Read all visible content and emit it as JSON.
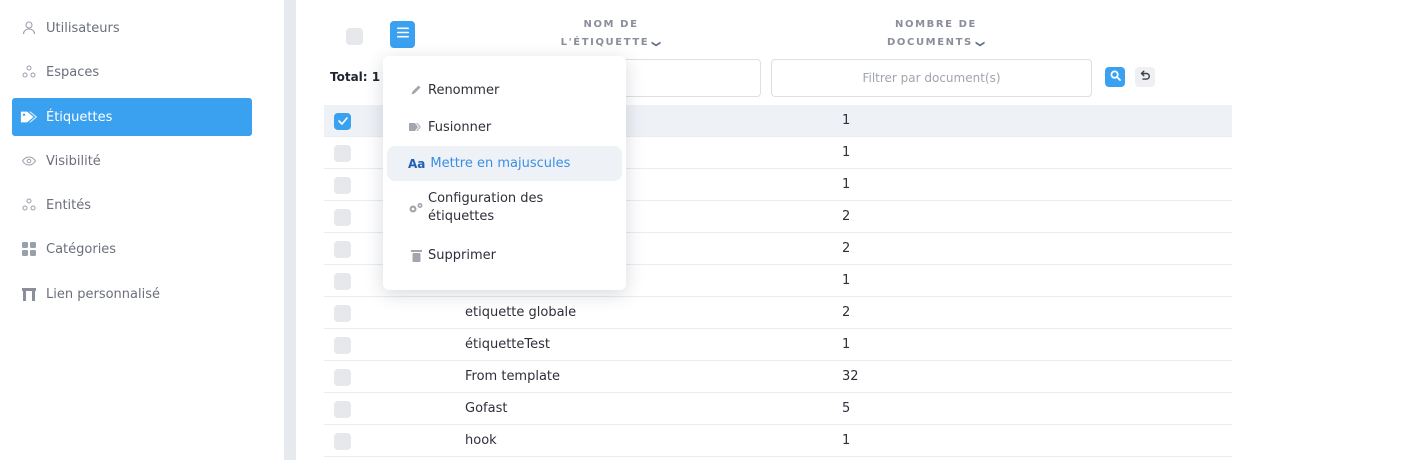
{
  "sidebar": {
    "items": [
      {
        "label": "Utilisateurs",
        "icon": "users-icon"
      },
      {
        "label": "Espaces",
        "icon": "spaces-icon"
      },
      {
        "label": "Étiquettes",
        "icon": "tags-icon",
        "active": true
      },
      {
        "label": "Visibilité",
        "icon": "eye-icon"
      },
      {
        "label": "Entités",
        "icon": "entities-icon"
      },
      {
        "label": "Catégories",
        "icon": "categories-icon"
      },
      {
        "label": "Lien personnalisé",
        "icon": "custom-link-icon"
      }
    ]
  },
  "table": {
    "col_name_line1": "NOM DE",
    "col_name_line2": "L'ÉTIQUETTE",
    "col_docs_line1": "NOMBRE DE",
    "col_docs_line2": "DOCUMENTS",
    "total_label": "Total: 1",
    "filter_doc_placeholder": "Filtrer par document(s)",
    "rows": [
      {
        "name": "",
        "count": "1",
        "checked": true
      },
      {
        "name": "",
        "count": "1"
      },
      {
        "name": "",
        "count": "1"
      },
      {
        "name": "",
        "count": "2"
      },
      {
        "name": "",
        "count": "2"
      },
      {
        "name": "",
        "count": "1"
      },
      {
        "name": "etiquette globale",
        "count": "2"
      },
      {
        "name": "étiquetteTest",
        "count": "1"
      },
      {
        "name": "From template",
        "count": "32"
      },
      {
        "name": "Gofast",
        "count": "5"
      },
      {
        "name": "hook",
        "count": "1"
      }
    ]
  },
  "menu": {
    "rename": "Renommer",
    "merge": "Fusionner",
    "uppercase_prefix": "Aa",
    "uppercase": "Mettre en majuscules",
    "config_line1": "Configuration des",
    "config_line2": "étiquettes",
    "delete": "Supprimer"
  },
  "colors": {
    "accent": "#3aa0f0",
    "highlight_text": "#3a8ee6"
  }
}
